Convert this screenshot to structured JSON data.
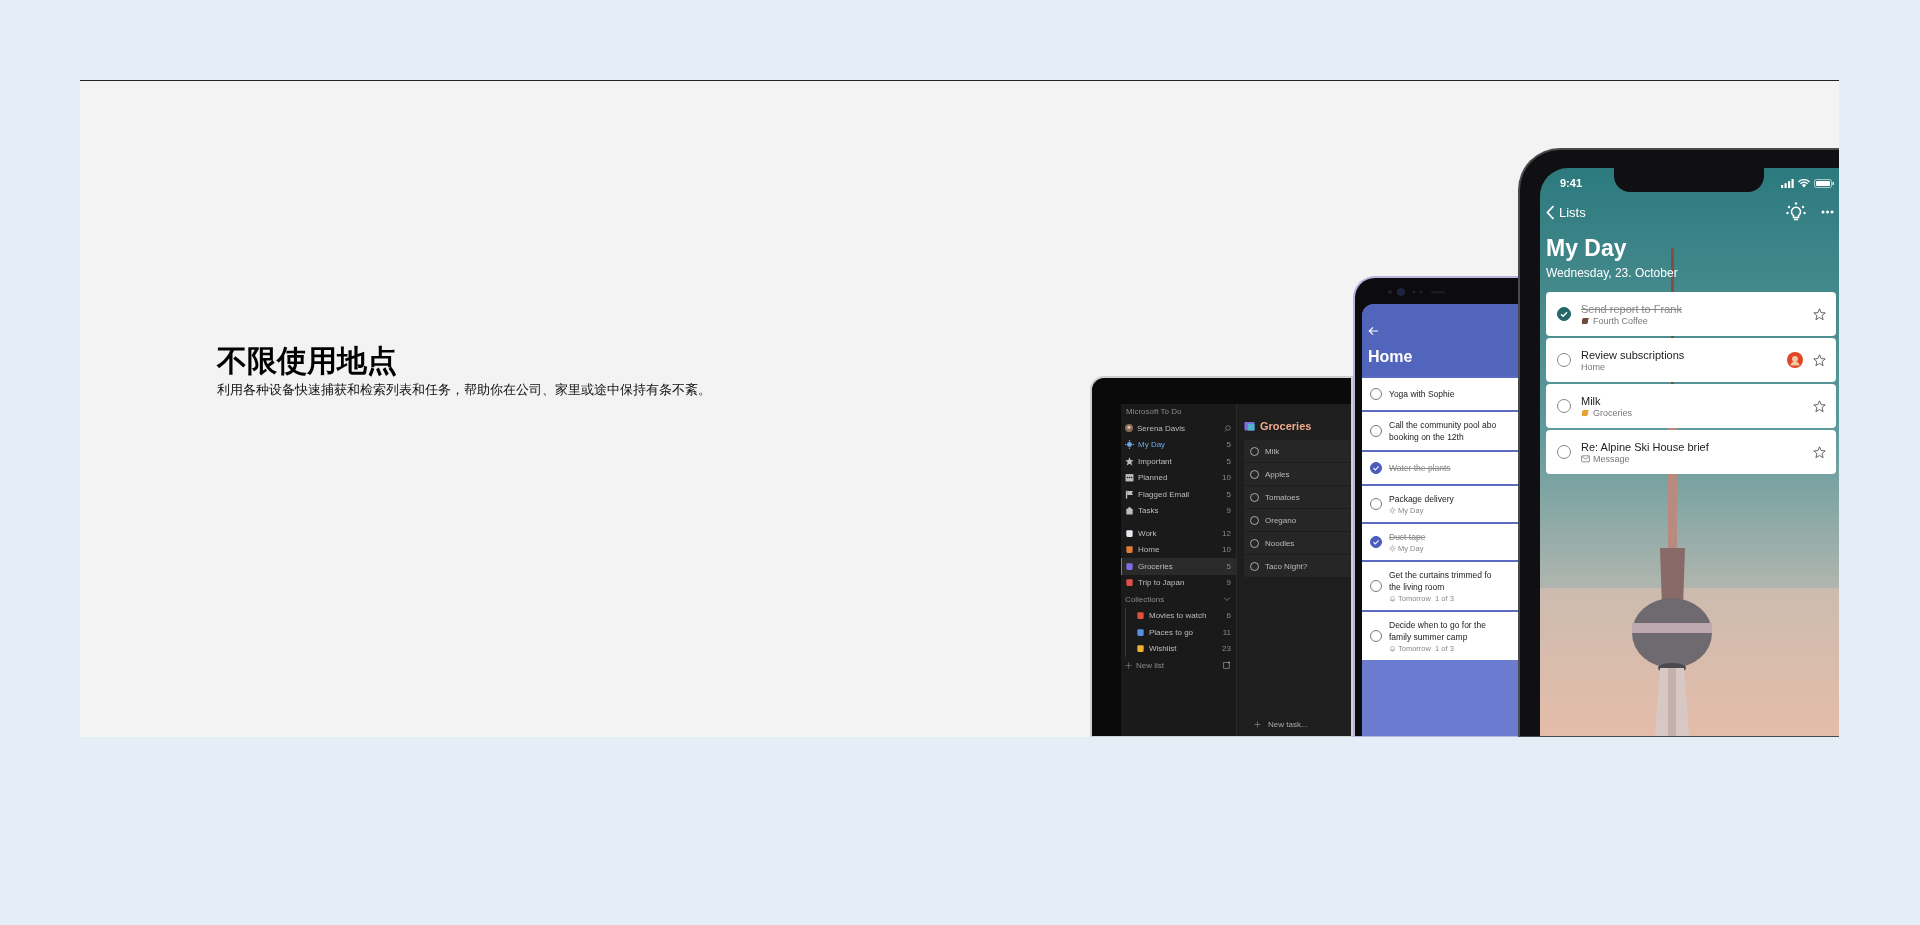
{
  "heading": "不限使用地点",
  "description": "利用各种设备快速捕获和检索列表和任务，帮助你在公司、家里或途中保持有条不紊。",
  "tablet": {
    "app_title": "Microsoft To Do",
    "user": "Serena Davis",
    "nav": [
      {
        "label": "My Day",
        "count": "5",
        "color": "#6ba6e8",
        "selected": false
      },
      {
        "label": "Important",
        "count": "5",
        "color": "#bdbdbd",
        "selected": false
      },
      {
        "label": "Planned",
        "count": "10",
        "color": "#bdbdbd",
        "selected": false
      },
      {
        "label": "Flagged Email",
        "count": "5",
        "color": "#bdbdbd",
        "selected": false
      },
      {
        "label": "Tasks",
        "count": "9",
        "color": "#bdbdbd",
        "selected": false
      }
    ],
    "lists": [
      {
        "label": "Work",
        "count": "12",
        "color": "#e8e8f0",
        "selected": false
      },
      {
        "label": "Home",
        "count": "10",
        "color": "#e07a3a",
        "selected": false
      },
      {
        "label": "Groceries",
        "count": "5",
        "color": "#7b6fe0",
        "selected": true
      },
      {
        "label": "Trip to Japan",
        "count": "9",
        "color": "#e0504a",
        "selected": false
      }
    ],
    "collections": {
      "label": "Collections",
      "expanded": true,
      "children": [
        {
          "label": "Movies to watch",
          "count": "6",
          "color": "#e0503a",
          "selected": false
        },
        {
          "label": "Places to go",
          "count": "11",
          "color": "#5a8fe0",
          "selected": false
        },
        {
          "label": "Wishlist",
          "count": "23",
          "color": "#f0b030",
          "selected": false
        }
      ]
    },
    "new_list": "New list",
    "list_title": "Groceries",
    "tasks": [
      {
        "title": "Milk",
        "completed": false
      },
      {
        "title": "Apples",
        "completed": false
      },
      {
        "title": "Tomatoes",
        "completed": false
      },
      {
        "title": "Oregano",
        "completed": false
      },
      {
        "title": "Noodles",
        "completed": false
      },
      {
        "title": "Taco Night?",
        "completed": false
      }
    ],
    "new_task": "New task..."
  },
  "android": {
    "title": "Home",
    "tasks": [
      {
        "title": "Yoga with Sophie",
        "completed": false
      },
      {
        "title": "Call the community pool abo\nbooking on the 12th",
        "completed": false
      },
      {
        "title": "Water the plants",
        "completed": true
      },
      {
        "title": "Package delivery",
        "completed": false,
        "meta": {
          "kind": "my_day",
          "text": "My Day"
        }
      },
      {
        "title": "Duct tape",
        "completed": true,
        "meta": {
          "kind": "my_day",
          "text": "My Day"
        }
      },
      {
        "title": "Get the curtains trimmed fo\nthe living room",
        "completed": false,
        "meta": {
          "kind": "reminder",
          "text": "Tomorrow  1 of 3"
        }
      },
      {
        "title": "Decide when to go for the\nfamily summer camp",
        "completed": false,
        "meta": {
          "kind": "reminder",
          "text": "Tomorrow  1 of 3"
        }
      }
    ]
  },
  "iphone": {
    "time": "9:41",
    "back": "Lists",
    "title": "My Day",
    "date": "Wednesday, 23. October",
    "tasks": [
      {
        "title": "Send report to Frank",
        "completed": true,
        "assigned": false,
        "subtitle": {
          "kind": "list",
          "color": "#6a4a3a",
          "text": "Fourth Coffee"
        }
      },
      {
        "title": "Review subscriptions",
        "completed": false,
        "assigned": true,
        "subtitle": {
          "kind": "plain",
          "text": "Home"
        }
      },
      {
        "title": "Milk",
        "completed": false,
        "assigned": false,
        "subtitle": {
          "kind": "list",
          "color": "#e8a030",
          "text": "Groceries"
        }
      },
      {
        "title": "Re: Alpine Ski House brief",
        "completed": false,
        "assigned": false,
        "subtitle": {
          "kind": "email",
          "text": "Message"
        }
      }
    ]
  }
}
